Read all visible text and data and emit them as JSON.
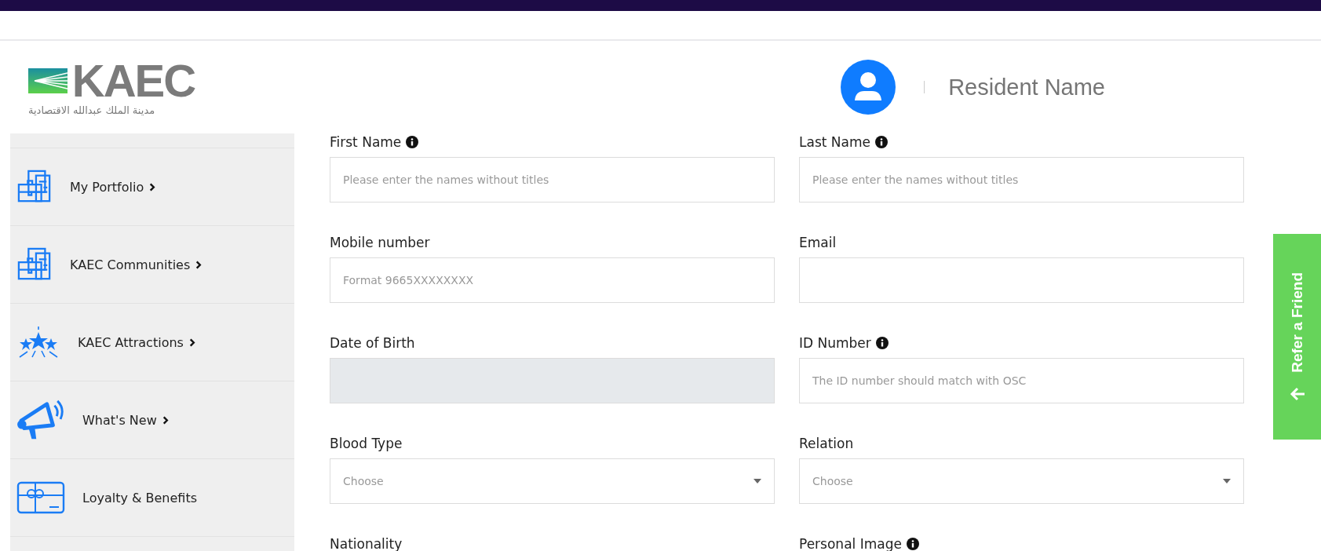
{
  "logo": {
    "text": "KAEC",
    "subtitle": "مدينة الملك عبدالله الاقتصادية"
  },
  "user": {
    "name": "Resident Name"
  },
  "sidebar": {
    "items": [
      {
        "label": "My Portfolio",
        "kind": "portfolio",
        "arrow": true
      },
      {
        "label": "KAEC Communities",
        "kind": "portfolio",
        "arrow": true
      },
      {
        "label": "KAEC Attractions",
        "kind": "stars",
        "arrow": true
      },
      {
        "label": "What's New",
        "kind": "megaphone",
        "arrow": true
      },
      {
        "label": "Loyalty & Benefits",
        "kind": "gift",
        "arrow": false
      }
    ]
  },
  "form": {
    "fields": [
      {
        "label": "First Name",
        "info": true,
        "kind": "text",
        "placeholder": "Please enter the names without titles",
        "disabled": false
      },
      {
        "label": "Last Name",
        "info": true,
        "kind": "text",
        "placeholder": "Please enter the names without titles",
        "disabled": false
      },
      {
        "label": "Mobile number",
        "info": false,
        "kind": "text",
        "placeholder": "Format 9665XXXXXXXX",
        "disabled": false
      },
      {
        "label": "Email",
        "info": false,
        "kind": "text",
        "disabled": false
      },
      {
        "label": "Date of Birth",
        "info": false,
        "kind": "text",
        "disabled": true
      },
      {
        "label": "ID Number",
        "info": true,
        "kind": "text",
        "placeholder": "The ID number should match with OSC",
        "disabled": false
      },
      {
        "label": "Blood Type",
        "info": false,
        "kind": "select",
        "placeholder": "Choose",
        "disabled": false
      },
      {
        "label": "Relation",
        "info": false,
        "kind": "select",
        "placeholder": "Choose",
        "disabled": false
      },
      {
        "label": "Nationality",
        "info": false,
        "kind": "label"
      },
      {
        "label": "Personal Image",
        "info": true,
        "kind": "label"
      }
    ]
  },
  "refer_tab": {
    "label": "Refer a Friend"
  }
}
